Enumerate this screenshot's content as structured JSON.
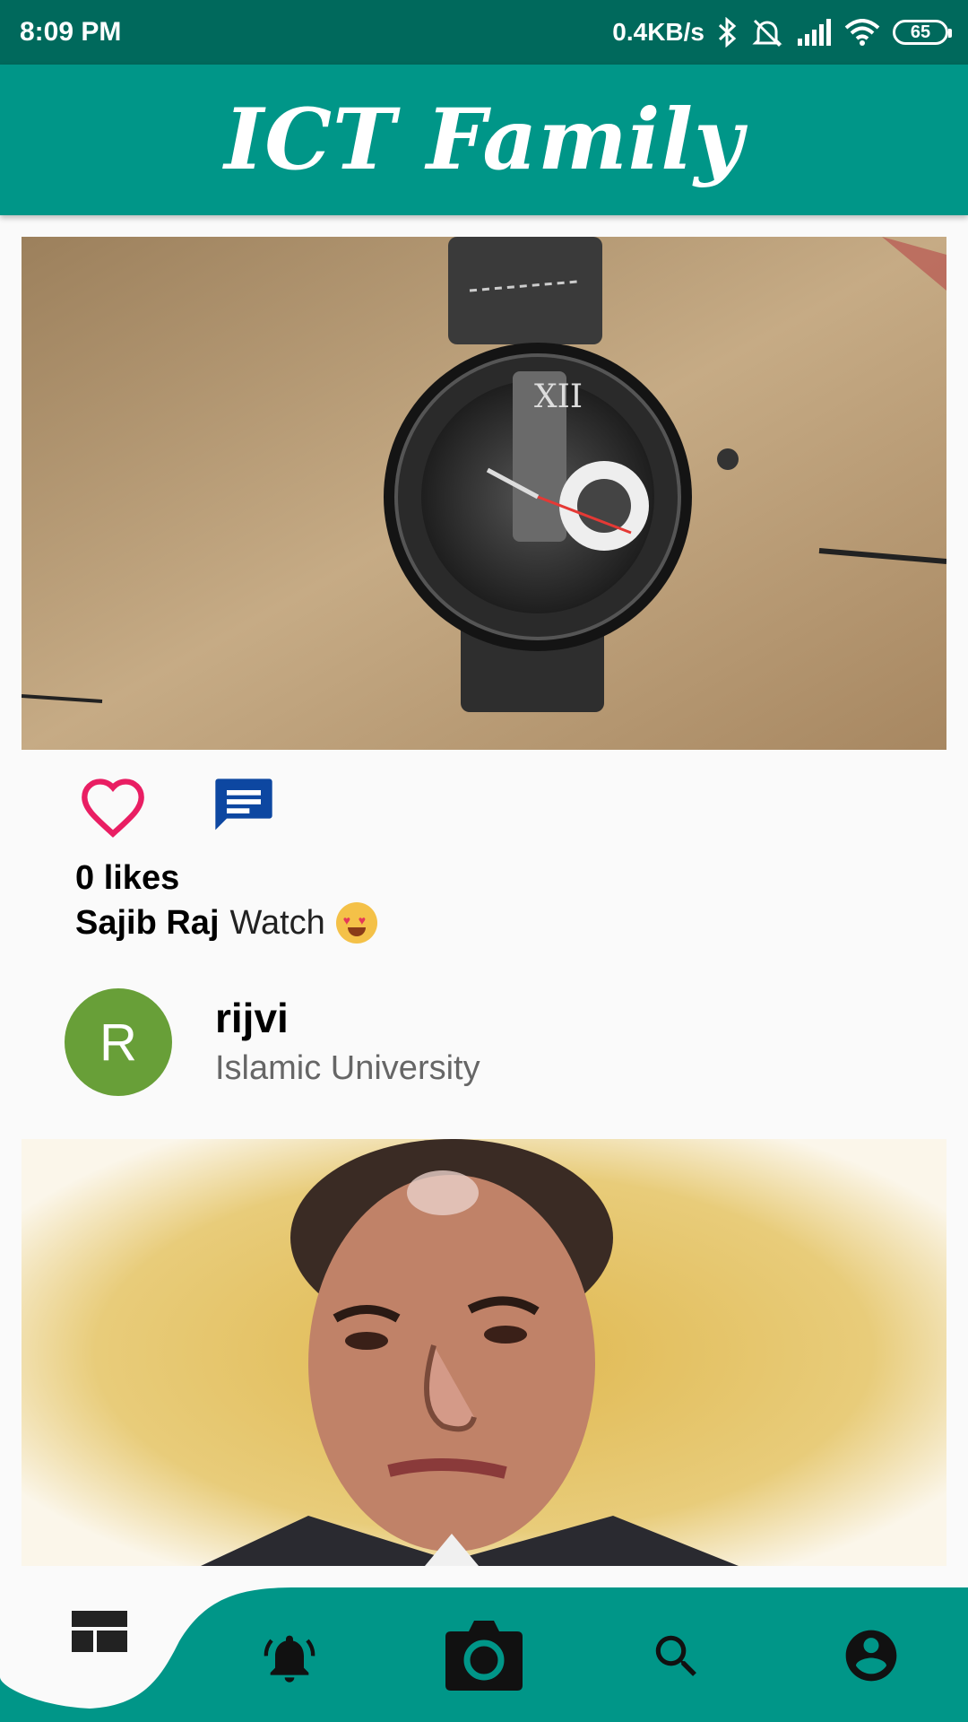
{
  "status_bar": {
    "time": "8:09 PM",
    "net_speed": "0.4KB/s",
    "battery": "65",
    "icons": [
      "bluetooth-icon",
      "alarm-off-icon",
      "signal-icon",
      "wifi-icon",
      "battery-icon"
    ]
  },
  "app_bar": {
    "title": "ICT Family"
  },
  "post": {
    "likes": "0 likes",
    "author": "Sajib Raj",
    "caption": "Watch",
    "icons": [
      "heart-outline-icon",
      "comment-icon"
    ]
  },
  "next_post": {
    "avatar_letter": "R",
    "user": "rijvi",
    "subtitle": "Islamic University"
  },
  "bottom_nav": {
    "items": [
      "feed-icon",
      "notifications-icon",
      "camera-icon",
      "search-icon",
      "account-icon"
    ],
    "active": "feed-icon"
  },
  "colors": {
    "status_bar": "#00695c",
    "primary": "#009688",
    "heart": "#e91e63",
    "comment": "#0d47a1",
    "avatar": "#689f38"
  }
}
